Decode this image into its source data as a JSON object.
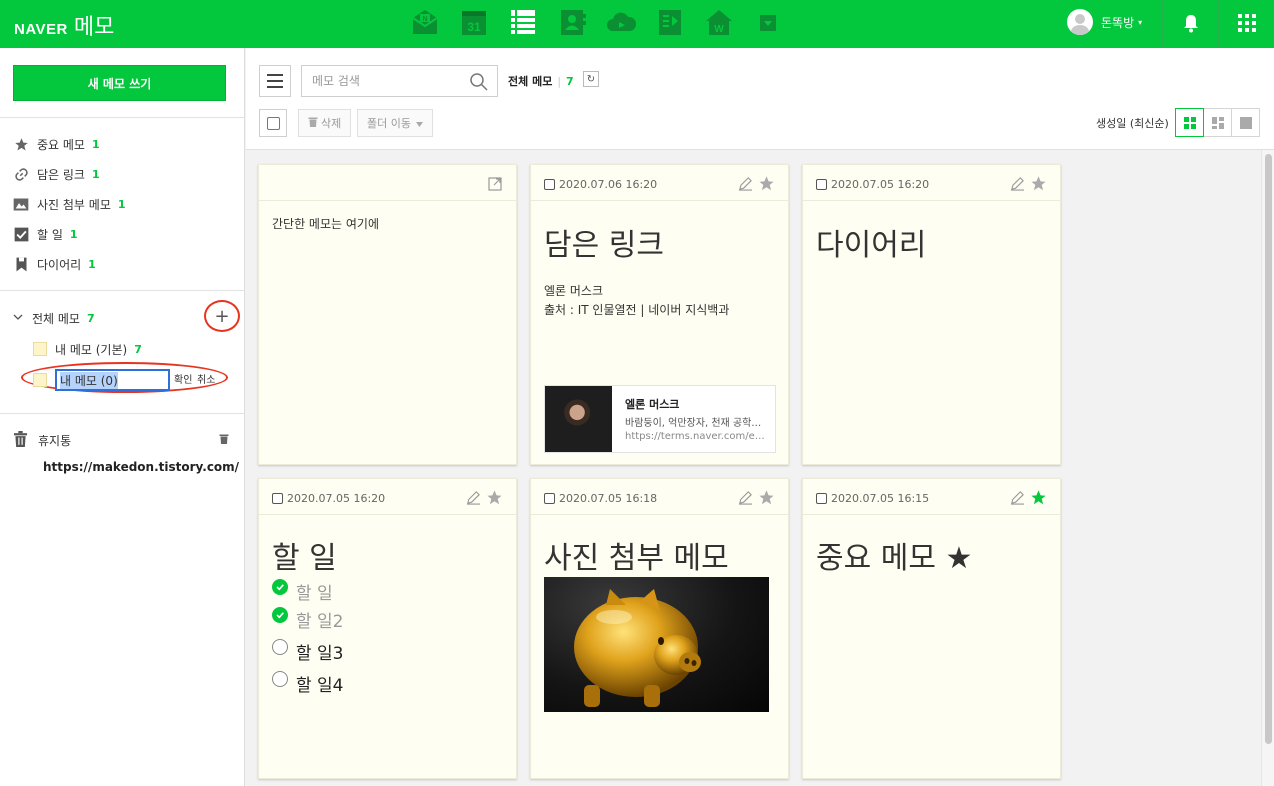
{
  "colors": {
    "brand": "#03c73c",
    "annotation": "#e8341f",
    "card": "#fefef2",
    "star_active": "#03c73c"
  },
  "header": {
    "logo_text": "NAVER",
    "service_name": "메모",
    "app_icons": [
      "mail-icon",
      "calendar-icon",
      "memo-list-icon",
      "contacts-icon",
      "cloud-icon",
      "office-icon",
      "blog-home-icon",
      "more-apps-dropdown-icon"
    ],
    "calendar_day": "31",
    "user_name": "돈똑방",
    "user_caret": "▾"
  },
  "sidebar": {
    "new_memo_label": "새 메모 쓰기",
    "categories": [
      {
        "label": "중요 메모",
        "count": "1",
        "icon": "star-icon"
      },
      {
        "label": "담은 링크",
        "count": "1",
        "icon": "link-icon"
      },
      {
        "label": "사진 첨부 메모",
        "count": "1",
        "icon": "photo-icon"
      },
      {
        "label": "할 일",
        "count": "1",
        "icon": "checkbox-icon"
      },
      {
        "label": "다이어리",
        "count": "1",
        "icon": "bookmark-icon"
      }
    ],
    "all_memo": {
      "label": "전체 메모",
      "count": "7"
    },
    "add_folder_label": "+",
    "folders": [
      {
        "label": "내 메모 (기본)",
        "count": "7"
      }
    ],
    "new_folder_input_value": "내 메모 (0)",
    "confirm_label": "확인",
    "cancel_label": "취소",
    "trash_label": "휴지통",
    "url_text": "https://makedon.tistory.com/"
  },
  "toolbar": {
    "search_placeholder": "메모 검색",
    "all_memo_label": "전체 메모",
    "all_memo_sep": "|",
    "all_memo_count": "7",
    "refresh_glyph": "↻",
    "delete_label": "삭제",
    "move_folder_label": "폴더 이동",
    "sort_label": "생성일 (최신순)",
    "view_modes": [
      "grid-view-icon",
      "masonry-view-icon",
      "single-view-icon"
    ]
  },
  "cards": [
    {
      "type": "quick",
      "text": "간단한 메모는 여기에"
    },
    {
      "type": "link",
      "date": "2020.07.06 16:20",
      "title": "담은 링크",
      "lines": [
        "엘론 머스크",
        "출처 : IT 인물열전 | 네이버 지식백과"
      ],
      "link": {
        "title": "엘론 머스크",
        "desc": "바람둥이, 억만장자, 천재 공학자, 그리고 또",
        "url": "https://terms.naver.com/entry"
      },
      "starred": false
    },
    {
      "type": "note",
      "date": "2020.07.05 16:20",
      "title": "다이어리",
      "starred": false
    },
    {
      "type": "todo",
      "date": "2020.07.05 16:20",
      "title": "할 일",
      "todos": [
        {
          "label": "할 일",
          "done": true
        },
        {
          "label": "할 일2",
          "done": true
        },
        {
          "label": "할 일3",
          "done": false
        },
        {
          "label": "할 일4",
          "done": false
        }
      ],
      "starred": false
    },
    {
      "type": "photo",
      "date": "2020.07.05 16:18",
      "title": "사진 첨부 메모",
      "starred": false
    },
    {
      "type": "note",
      "date": "2020.07.05 16:15",
      "title": "중요 메모 ★",
      "starred": true
    }
  ]
}
